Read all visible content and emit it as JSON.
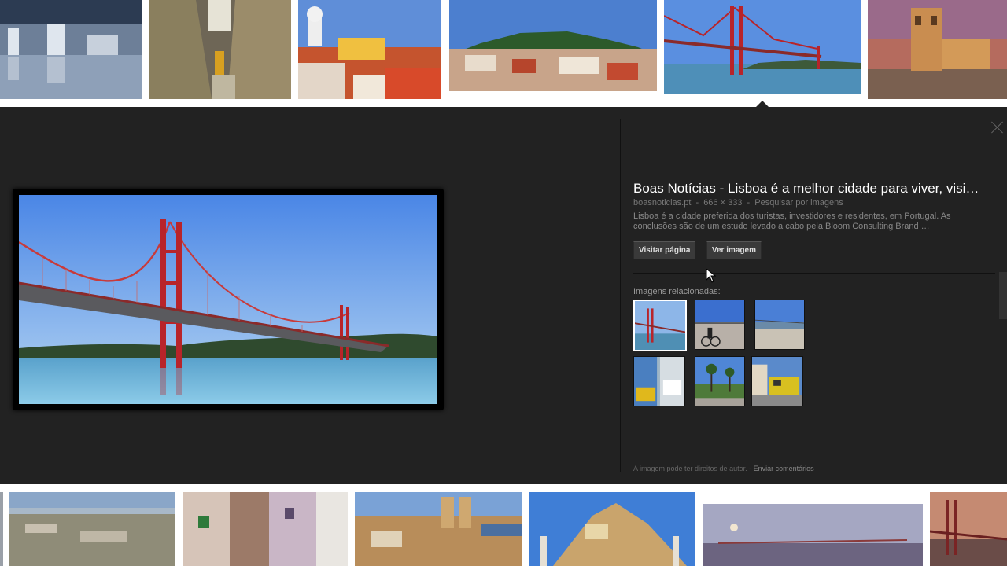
{
  "top_thumbnails": [
    {
      "name": "lisbon-waterfront-night",
      "sky": "#2c3b52",
      "ground": "#8ea0b8"
    },
    {
      "name": "lisbon-street-tram",
      "sky": "#cfc7a5",
      "ground": "#6e6656"
    },
    {
      "name": "lisbon-rooftops-church",
      "sky": "#5f8ed8",
      "ground": "#c5542e"
    },
    {
      "name": "lisbon-hill-panorama",
      "sky": "#4c7fcf",
      "ground": "#b77b52"
    },
    {
      "name": "ponte-25-abril",
      "sky": "#5a8fe0",
      "ground": "#4e8fb8"
    },
    {
      "name": "torre-de-belem",
      "sky": "#b56b5e",
      "ground": "#7a6050"
    }
  ],
  "bottom_thumbnails": [
    {
      "name": "lisbon-city-aerial",
      "sky": "#8aa6c8",
      "ground": "#8f8c78"
    },
    {
      "name": "lisbon-colorful-buildings",
      "sky": "#e9e6e1",
      "ground": "#9c7a68"
    },
    {
      "name": "lisbon-se-cathedral",
      "sky": "#7aa2d6",
      "ground": "#b88d5a"
    },
    {
      "name": "lisbon-castle-hill",
      "sky": "#3f7ed6",
      "ground": "#c9a46c"
    },
    {
      "name": "lisbon-sunset-bridge",
      "sky": "#a5a7c2",
      "ground": "#6c6480"
    },
    {
      "name": "ponte-25-abril-sunset",
      "sky": "#c58a72",
      "ground": "#6a4c48"
    }
  ],
  "preview": {
    "title": "Boas Notícias - Lisboa é a melhor cidade para viver, visi…",
    "source": "boasnoticias.pt",
    "dimensions": "666 × 333",
    "search_by_image": "Pesquisar por imagens",
    "separator": "-",
    "description": "Lisboa é a cidade preferida dos turistas, investidores e residentes, em Portugal. As conclusões são de um estudo levado a cabo pela Bloom Consulting Brand …",
    "visit_button": "Visitar página",
    "view_button": "Ver imagem",
    "related_label": "Imagens relacionadas:",
    "footer_text": "A imagem pode ter direitos de autor.",
    "footer_separator": "-",
    "footer_link": "Enviar comentários"
  },
  "related_images": [
    {
      "name": "related-bridge",
      "sky": "#8db6e8",
      "ground": "#4f8fb4",
      "selected": true
    },
    {
      "name": "related-cyclist-pier",
      "sky": "#3b6fcf",
      "ground": "#b8b0a8"
    },
    {
      "name": "related-river-bridge",
      "sky": "#4a7fd6",
      "ground": "#c9c2b5"
    },
    {
      "name": "related-yellow-car-ferry",
      "sky": "#9fb6c6",
      "ground": "#e0b81c"
    },
    {
      "name": "related-palm-square",
      "sky": "#4f86d6",
      "ground": "#4e7a3a"
    },
    {
      "name": "related-yellow-tram",
      "sky": "#5a8acb",
      "ground": "#d8c020"
    }
  ],
  "colors": {
    "panel_bg": "#222222",
    "bridge_red": "#b8242a",
    "accent_text": "#ffffff"
  }
}
